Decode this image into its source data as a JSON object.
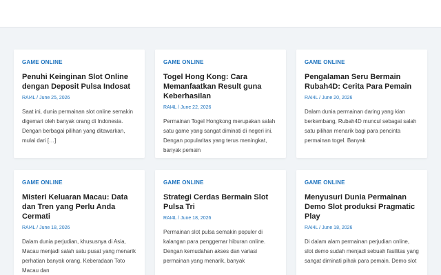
{
  "posts": [
    {
      "category": "GAME ONLINE",
      "title": "Penuhi Keinginan Slot Online dengan Deposit Pulsa Indosat",
      "author": "RAI4L",
      "date": "June 25, 2026",
      "excerpt": "Saat ini, dunia permainan slot online semakin digemari oleh banyak orang di Indonesia. Dengan berbagai pilihan yang ditawarkan, mulai dari […]"
    },
    {
      "category": "GAME ONLINE",
      "title": "Togel Hong Kong: Cara Memanfaatkan Result guna Keberhasilan",
      "author": "RAI4L",
      "date": "June 22, 2026",
      "excerpt": "Permainan Togel Hongkong merupakan salah satu game yang sangat diminati di negeri ini. Dengan popularitas yang terus meningkat, banyak pemain"
    },
    {
      "category": "GAME ONLINE",
      "title": "Pengalaman Seru Bermain Rubah4D: Cerita Para Pemain",
      "author": "RAI4L",
      "date": "June 20, 2026",
      "excerpt": "Dalam dunia permainan daring yang kian berkembang, Rubah4D muncul sebagai salah satu pilihan menarik bagi para pencinta permainan togel. Banyak"
    },
    {
      "category": "GAME ONLINE",
      "title": "Misteri Keluaran Macau: Data dan Tren yang Perlu Anda Cermati",
      "author": "RAI4L",
      "date": "June 18, 2026",
      "excerpt": "Dalam dunia perjudian, khususnya di Asia, Macau menjadi salah satu pusat yang menarik perhatian banyak orang. Keberadaan Toto Macau dan"
    },
    {
      "category": "GAME ONLINE",
      "title": "Strategi Cerdas Bermain Slot Pulsa Tri",
      "author": "RAI4L",
      "date": "June 18, 2026",
      "excerpt": "Permainan slot pulsa semakin populer di kalangan para penggemar hiburan online. Dengan kemudahan akses dan variasi permainan yang menarik, banyak"
    },
    {
      "category": "GAME ONLINE",
      "title": "Menyusuri Dunia Permainan Demo Slot produksi Pragmatic Play",
      "author": "RAI4L",
      "date": "June 18, 2026",
      "excerpt": "Di dalam alam permainan perjudian online, slot demo sudah menjadi sebuah fasilitas yang sangat diminati pihak para pemain. Demo slot"
    }
  ],
  "meta_separator": "/"
}
